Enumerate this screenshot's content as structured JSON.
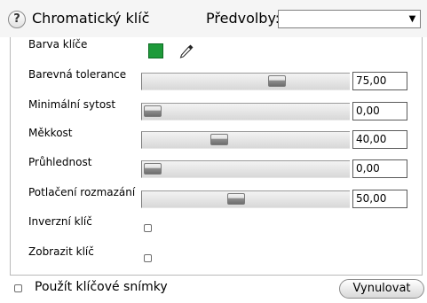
{
  "header": {
    "help_label": "?",
    "title": "Chromatický klíč",
    "presets_label": "Předvolby:",
    "presets_value": ""
  },
  "properties": {
    "key_color": {
      "label": "Barva klíče",
      "color": "#1e9a3a",
      "icon": "eyedropper-icon"
    },
    "sliders": [
      {
        "id": "tolerance",
        "label": "Barevná tolerance",
        "value": "75,00",
        "fraction": 0.75
      },
      {
        "id": "min-saturation",
        "label": "Minimální sytost",
        "value": "0,00",
        "fraction": 0.0
      },
      {
        "id": "softness",
        "label": "Měkkost",
        "value": "40,00",
        "fraction": 0.4
      },
      {
        "id": "transparency",
        "label": "Průhlednost",
        "value": "0,00",
        "fraction": 0.0
      },
      {
        "id": "blur-suppression",
        "label": "Potlačení rozmazání",
        "value": "50,00",
        "fraction": 0.5
      }
    ],
    "invert_key": {
      "label": "Inverzní klíč",
      "checked": false
    },
    "show_key": {
      "label": "Zobrazit klíč",
      "checked": false
    }
  },
  "footer": {
    "keyframes_label": "Použít klíčové snímky",
    "keyframes_checked": false,
    "reset_label": "Vynulovat"
  }
}
